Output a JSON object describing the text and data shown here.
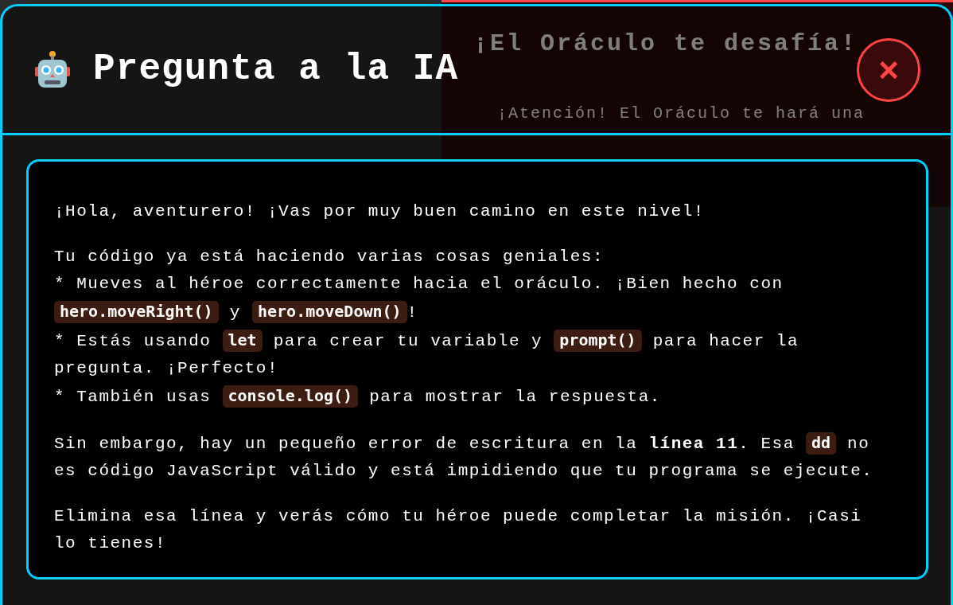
{
  "background": {
    "title": "¡El Oráculo te desafía!",
    "notice": "¡Atención! El Oráculo te hará una"
  },
  "modal": {
    "title": "Pregunta a la IA",
    "close_label": "×",
    "paragraphs": [
      [
        {
          "kind": "text",
          "text": "¡Hola, aventurero! ¡Vas por muy buen camino en este nivel!"
        }
      ],
      [
        {
          "kind": "text",
          "text": "Tu código ya está haciendo varias cosas geniales:\n* Mueves al héroe correctamente hacia el oráculo. ¡Bien hecho con "
        },
        {
          "kind": "code",
          "text": "hero.moveRight()"
        },
        {
          "kind": "text",
          "text": " y "
        },
        {
          "kind": "code",
          "text": "hero.moveDown()"
        },
        {
          "kind": "text",
          "text": "!\n* Estás usando "
        },
        {
          "kind": "code",
          "text": "let"
        },
        {
          "kind": "text",
          "text": " para crear tu variable y "
        },
        {
          "kind": "code",
          "text": "prompt()"
        },
        {
          "kind": "text",
          "text": " para hacer la pregunta. ¡Perfecto!\n* También usas "
        },
        {
          "kind": "code",
          "text": "console.log()"
        },
        {
          "kind": "text",
          "text": " para mostrar la respuesta."
        }
      ],
      [
        {
          "kind": "text",
          "text": "Sin embargo, hay un pequeño error de escritura en la **línea 11**. Esa "
        },
        {
          "kind": "code",
          "text": "dd"
        },
        {
          "kind": "text",
          "text": " no es código JavaScript válido y está impidiendo que tu programa se ejecute."
        }
      ],
      [
        {
          "kind": "text",
          "text": "Elimina esa línea y verás cómo tu héroe puede completar la misión. ¡Casi lo tienes!"
        }
      ]
    ]
  }
}
